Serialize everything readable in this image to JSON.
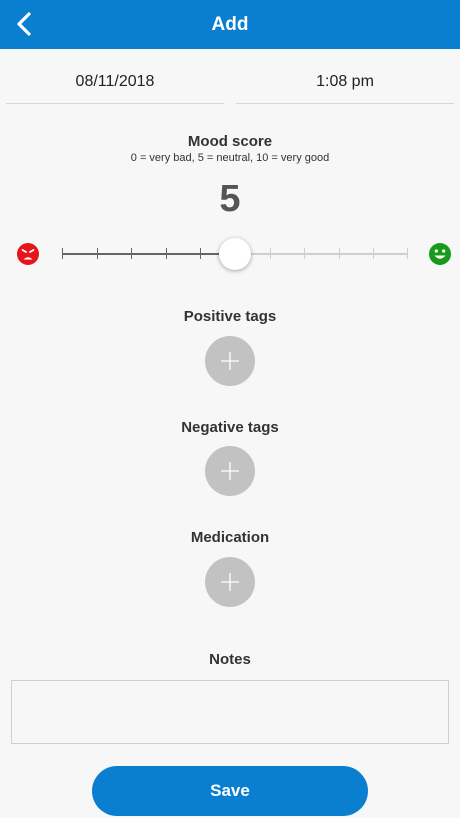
{
  "header": {
    "title": "Add",
    "back_icon": "chevron-left-icon"
  },
  "entry": {
    "date": "08/11/2018",
    "time": "1:08 pm"
  },
  "mood": {
    "title": "Mood score",
    "subtitle": "0 = very bad, 5 = neutral, 10 = very good",
    "value": "5",
    "min": 0,
    "max": 10,
    "level": 5,
    "sad_icon": "sad-face-icon",
    "happy_icon": "happy-face-icon",
    "sad_color": "#e8141b",
    "happy_color": "#1a9a1a"
  },
  "sections": {
    "positive_tags": "Positive tags",
    "negative_tags": "Negative tags",
    "medication": "Medication",
    "add_icon": "plus-icon"
  },
  "notes": {
    "title": "Notes",
    "value": ""
  },
  "actions": {
    "save_label": "Save"
  },
  "colors": {
    "accent": "#0a7fd0",
    "add_button": "#c2c2c2"
  }
}
